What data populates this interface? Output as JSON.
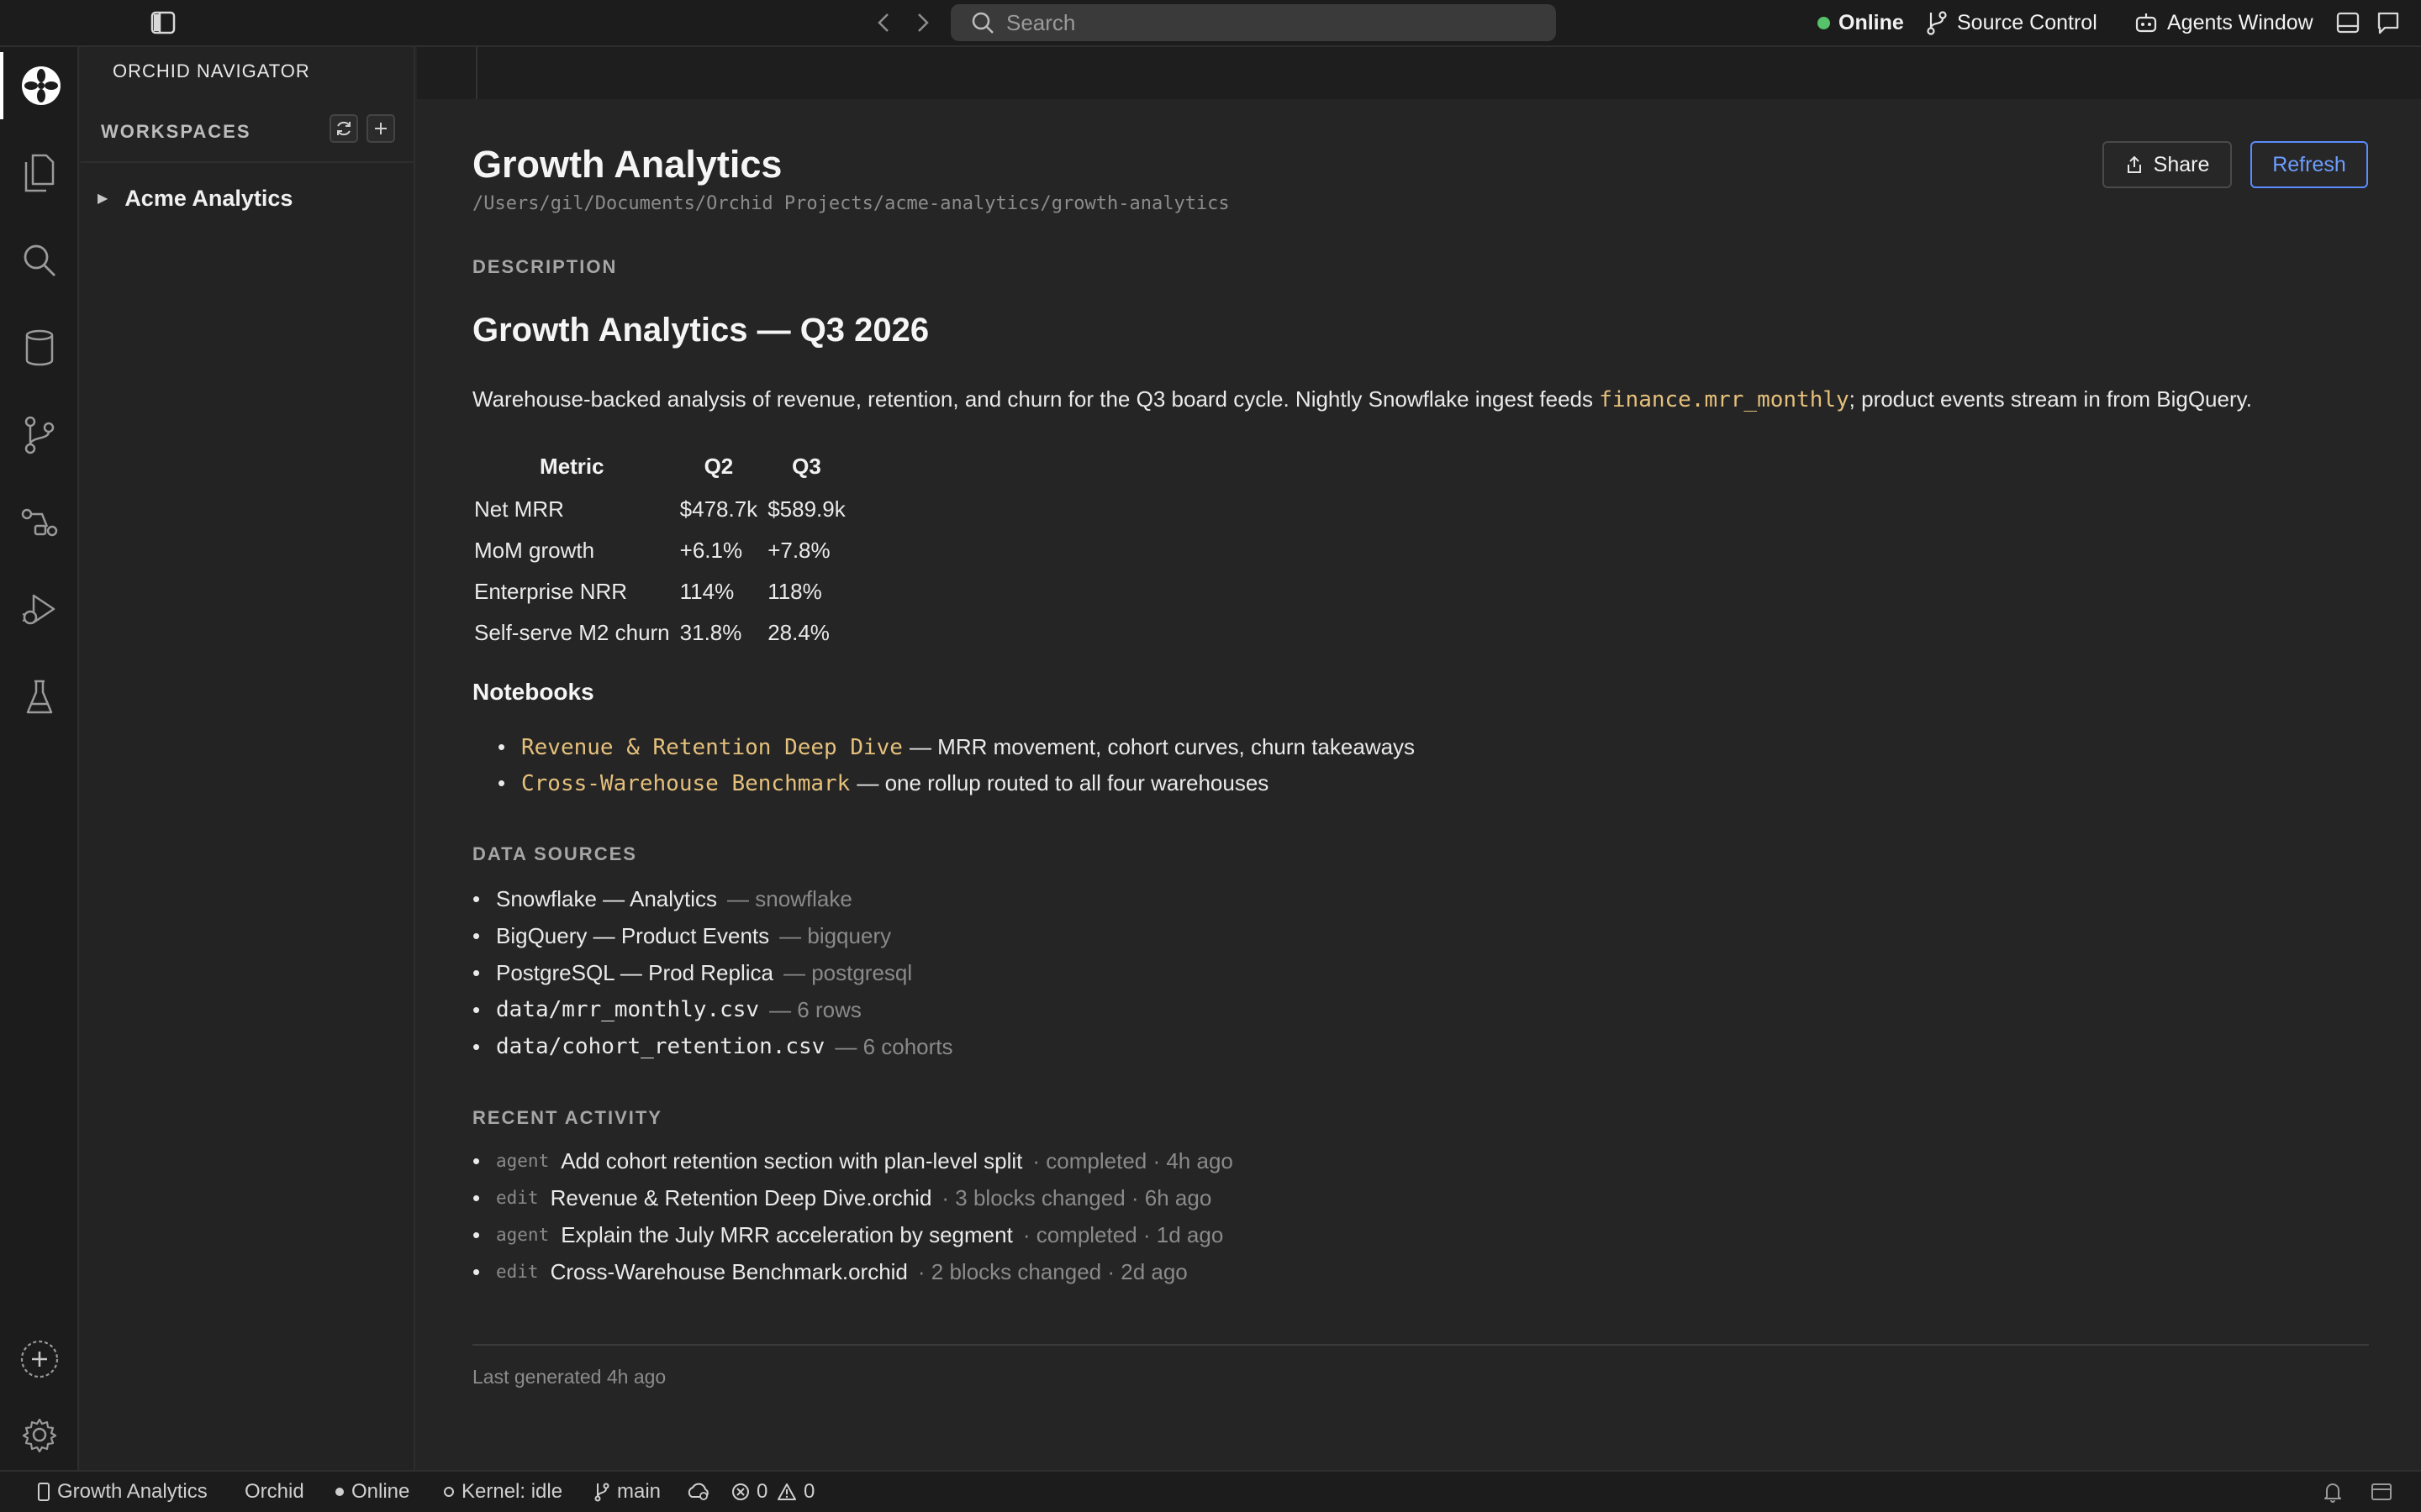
{
  "titlebar": {
    "search_placeholder": "Search",
    "status_online": "Online",
    "source_control": "Source Control",
    "agents_window": "Agents Window"
  },
  "activitybar": {
    "icons": [
      "orchid-logo-icon",
      "files-icon",
      "search-icon",
      "database-icon",
      "source-control-icon",
      "pipeline-icon",
      "run-debug-icon",
      "flask-icon",
      "add-icon",
      "gear-icon"
    ]
  },
  "sidebar": {
    "title": "ORCHID NAVIGATOR",
    "section": "WORKSPACES",
    "workspaces": [
      {
        "label": "Acme Analytics"
      }
    ]
  },
  "page": {
    "title": "Growth Analytics",
    "path": "/Users/gil/Documents/Orchid Projects/acme-analytics/growth-analytics",
    "share": "Share",
    "refresh": "Refresh",
    "description_label": "DESCRIPTION",
    "heading": "Growth Analytics — Q3 2026",
    "desc_before": "Warehouse-backed analysis of revenue, retention, and churn for the Q3 board cycle. Nightly Snowflake ingest feeds ",
    "desc_code": "finance.mrr_monthly",
    "desc_after": "; product events stream in from BigQuery.",
    "table": {
      "headers": [
        "Metric",
        "Q2",
        "Q3"
      ],
      "rows": [
        [
          "Net MRR",
          "$478.7k",
          "$589.9k"
        ],
        [
          "MoM growth",
          "+6.1%",
          "+7.8%"
        ],
        [
          "Enterprise NRR",
          "114%",
          "118%"
        ],
        [
          "Self-serve M2 churn",
          "31.8%",
          "28.4%"
        ]
      ]
    },
    "notebooks_heading": "Notebooks",
    "notebooks": [
      {
        "name": "Revenue & Retention Deep Dive",
        "desc": "— MRR movement, cohort curves, churn takeaways"
      },
      {
        "name": "Cross-Warehouse Benchmark",
        "desc": "— one rollup routed to all four warehouses"
      }
    ],
    "data_sources_label": "DATA SOURCES",
    "data_sources": [
      {
        "name": "Snowflake — Analytics",
        "meta": "— snowflake"
      },
      {
        "name": "BigQuery — Product Events",
        "meta": "— bigquery"
      },
      {
        "name": "PostgreSQL — Prod Replica",
        "meta": "— postgresql"
      },
      {
        "name": "data/mrr_monthly.csv",
        "meta": "— 6 rows"
      },
      {
        "name": "data/cohort_retention.csv",
        "meta": "— 6 cohorts"
      }
    ],
    "recent_label": "RECENT ACTIVITY",
    "activity": [
      {
        "tag": "agent",
        "text": "Add cohort retention section with plan-level split",
        "meta": "· completed · 4h ago"
      },
      {
        "tag": "edit",
        "text": "Revenue & Retention Deep Dive.orchid",
        "meta": "· 3 blocks changed · 6h ago"
      },
      {
        "tag": "agent",
        "text": "Explain the July MRR acceleration by segment",
        "meta": "· completed · 1d ago"
      },
      {
        "tag": "edit",
        "text": "Cross-Warehouse Benchmark.orchid",
        "meta": "· 2 blocks changed · 2d ago"
      }
    ],
    "last_generated": "Last generated 4h ago"
  },
  "statusbar": {
    "project": "Growth Analytics",
    "app": "Orchid",
    "online": "Online",
    "kernel": "Kernel: idle",
    "branch": "main",
    "errors": "0",
    "warnings": "0"
  }
}
